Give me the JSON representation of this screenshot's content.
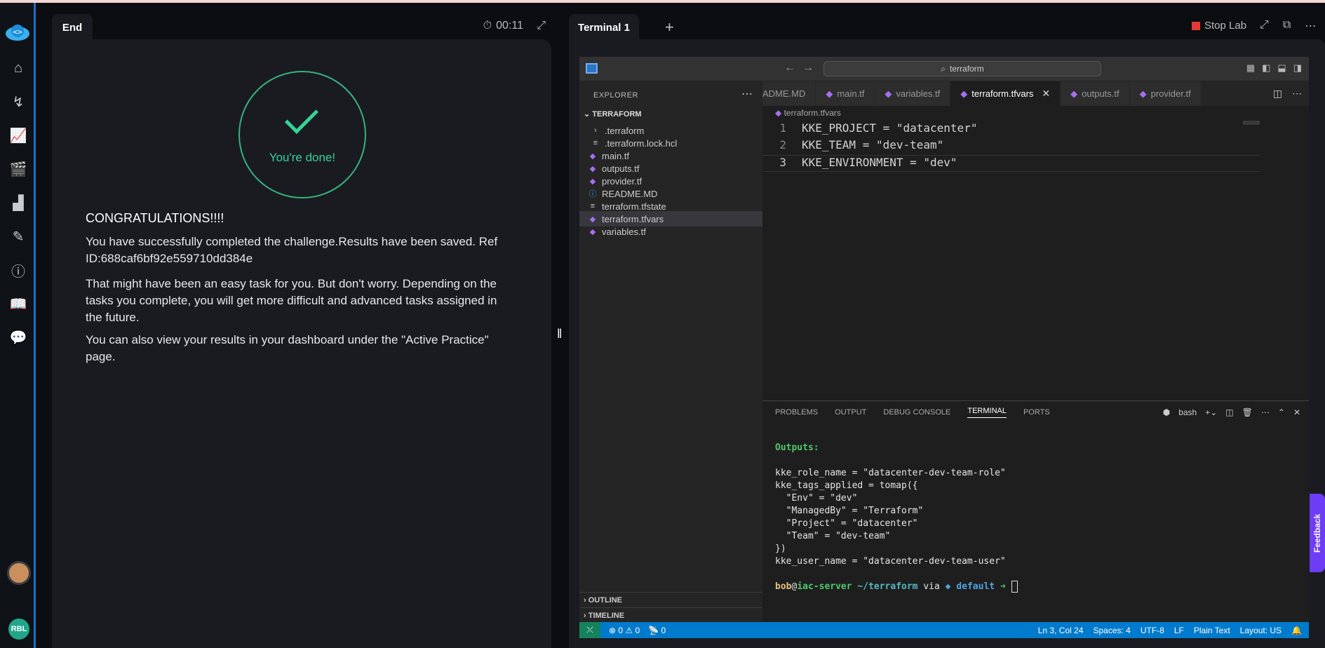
{
  "rail": {
    "icons": [
      "home-icon",
      "route-icon",
      "chart-icon",
      "clapper-icon",
      "podium-icon",
      "notes-icon",
      "info-icon",
      "book-icon",
      "chat-icon"
    ],
    "user_initials": "RBL"
  },
  "left": {
    "tab_label": "End",
    "timer": "00:11",
    "done_text": "You're done!",
    "congrats": "CONGRATULATIONS!!!!",
    "p1": "You have successfully completed the challenge.Results have been saved. Ref ID:688caf6bf92e559710dd384e",
    "p2": "That might have been an easy task for you. But don't worry. Depending on the tasks you complete, you will get more difficult and advanced tasks assigned in the future.",
    "p3": "You can also view your results in your dashboard under the \"Active Practice\" page."
  },
  "right": {
    "tab_label": "Terminal 1",
    "plus": "+",
    "stop_lab": "Stop Lab",
    "accent": "#007acc"
  },
  "vscode": {
    "search": "terraform",
    "explorer_label": "EXPLORER",
    "root": "TERRAFORM",
    "files": [
      {
        "name": ".terraform",
        "type": "folder"
      },
      {
        "name": ".terraform.lock.hcl",
        "type": "file"
      },
      {
        "name": "main.tf",
        "type": "tf"
      },
      {
        "name": "outputs.tf",
        "type": "tf"
      },
      {
        "name": "provider.tf",
        "type": "tf"
      },
      {
        "name": "README.MD",
        "type": "info"
      },
      {
        "name": "terraform.tfstate",
        "type": "file"
      },
      {
        "name": "terraform.tfvars",
        "type": "tf"
      },
      {
        "name": "variables.tf",
        "type": "tf"
      }
    ],
    "outline": "OUTLINE",
    "timeline": "TIMELINE",
    "tabs": [
      "ADME.MD",
      "main.tf",
      "variables.tf",
      "terraform.tfvars",
      "outputs.tf",
      "provider.tf"
    ],
    "active_tab": "terraform.tfvars",
    "breadcrumb": "terraform.tfvars",
    "code": [
      {
        "n": "1",
        "text": "KKE_PROJECT     = \"datacenter\""
      },
      {
        "n": "2",
        "text": "KKE_TEAM        = \"dev-team\""
      },
      {
        "n": "3",
        "text": "KKE_ENVIRONMENT = \"dev\""
      }
    ],
    "panel_tabs": [
      "PROBLEMS",
      "OUTPUT",
      "DEBUG CONSOLE",
      "TERMINAL",
      "PORTS"
    ],
    "active_panel": "TERMINAL",
    "shell": "bash",
    "terminal": {
      "outputs_header": "Outputs:",
      "lines": [
        "kke_role_name = \"datacenter-dev-team-role\"",
        "kke_tags_applied = tomap({",
        "  \"Env\" = \"dev\"",
        "  \"ManagedBy\" = \"Terraform\"",
        "  \"Project\" = \"datacenter\"",
        "  \"Team\" = \"dev-team\"",
        "})",
        "kke_user_name = \"datacenter-dev-team-user\""
      ],
      "prompt_user": "bob",
      "prompt_at": "@",
      "prompt_host": "iac-server",
      "prompt_path": " ~/terraform",
      "prompt_via": " via ",
      "prompt_ws": "◆ default",
      "prompt_arrow": " ➜ "
    },
    "status": {
      "errors": "0",
      "warnings": "0",
      "ports": "0",
      "position": "Ln 3, Col 24",
      "spaces": "Spaces: 4",
      "encoding": "UTF-8",
      "eol": "LF",
      "lang": "Plain Text",
      "layout": "Layout: US"
    }
  },
  "feedback": "Feedback"
}
